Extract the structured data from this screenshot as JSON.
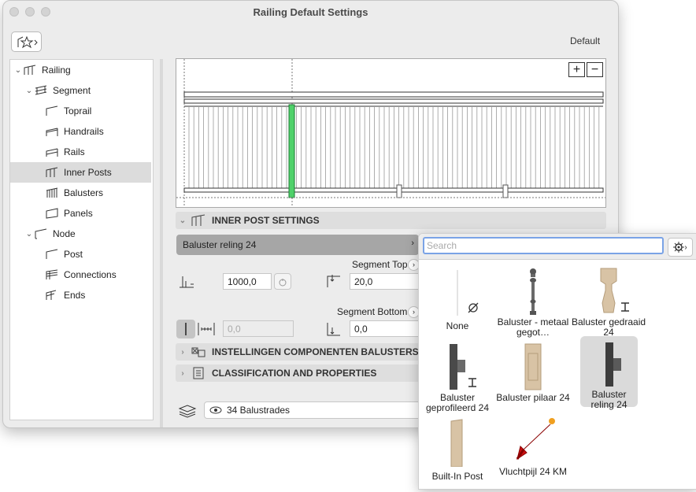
{
  "window": {
    "title": "Railing Default Settings",
    "default_label": "Default"
  },
  "tree": [
    {
      "label": "Railing",
      "icon": "railing-icon",
      "level": 0,
      "expanded": true
    },
    {
      "label": "Segment",
      "icon": "segment-icon",
      "level": 1,
      "expanded": true
    },
    {
      "label": "Toprail",
      "icon": "toprail-icon",
      "level": 2
    },
    {
      "label": "Handrails",
      "icon": "handrails-icon",
      "level": 2
    },
    {
      "label": "Rails",
      "icon": "rails-icon",
      "level": 2
    },
    {
      "label": "Inner Posts",
      "icon": "inner-posts-icon",
      "level": 2,
      "selected": true
    },
    {
      "label": "Balusters",
      "icon": "balusters-icon",
      "level": 2
    },
    {
      "label": "Panels",
      "icon": "panels-icon",
      "level": 2
    },
    {
      "label": "Node",
      "icon": "node-icon",
      "level": 1,
      "expanded": true
    },
    {
      "label": "Post",
      "icon": "post-icon",
      "level": 2
    },
    {
      "label": "Connections",
      "icon": "connections-icon",
      "level": 2
    },
    {
      "label": "Ends",
      "icon": "ends-icon",
      "level": 2
    }
  ],
  "sections": {
    "inner_post": "INNER POST SETTINGS",
    "components": "INSTELLINGEN COMPONENTEN BALUSTERS",
    "classification": "CLASSIFICATION AND PROPERTIES"
  },
  "settings": {
    "combo_value": "Baluster reling 24",
    "segment_top_label": "Segment Top",
    "segment_bottom_label": "Segment Bottom",
    "height_value": "1000,0",
    "top_offset_value": "20,0",
    "disabled_value": "0,0",
    "bottom_offset_value": "0,0"
  },
  "layer": {
    "value": "34 Balustrades"
  },
  "popover": {
    "search_placeholder": "Search",
    "items": [
      {
        "name": "None",
        "icon": "none-icon"
      },
      {
        "name": "Baluster - metaal gegot…",
        "icon": "metal-baluster-icon"
      },
      {
        "name": "Baluster gedraaid 24",
        "icon": "turned-baluster-icon"
      },
      {
        "name": "Baluster geprofileerd 24",
        "icon": "profiled-baluster-icon"
      },
      {
        "name": "Baluster pilaar 24",
        "icon": "pillar-baluster-icon"
      },
      {
        "name": "Baluster reling 24",
        "icon": "reling-baluster-icon",
        "selected": true
      },
      {
        "name": "Built-In Post",
        "icon": "built-in-post-icon"
      },
      {
        "name": "Vluchtpijl 24 KM",
        "icon": "arrow-icon"
      }
    ]
  },
  "colors": {
    "accent_focus": "#7aa3e6",
    "selected_post": "#4fd16a",
    "wood": "#d8c3a5",
    "metal": "#4a4a4a",
    "arrow_red": "#cc1111"
  }
}
